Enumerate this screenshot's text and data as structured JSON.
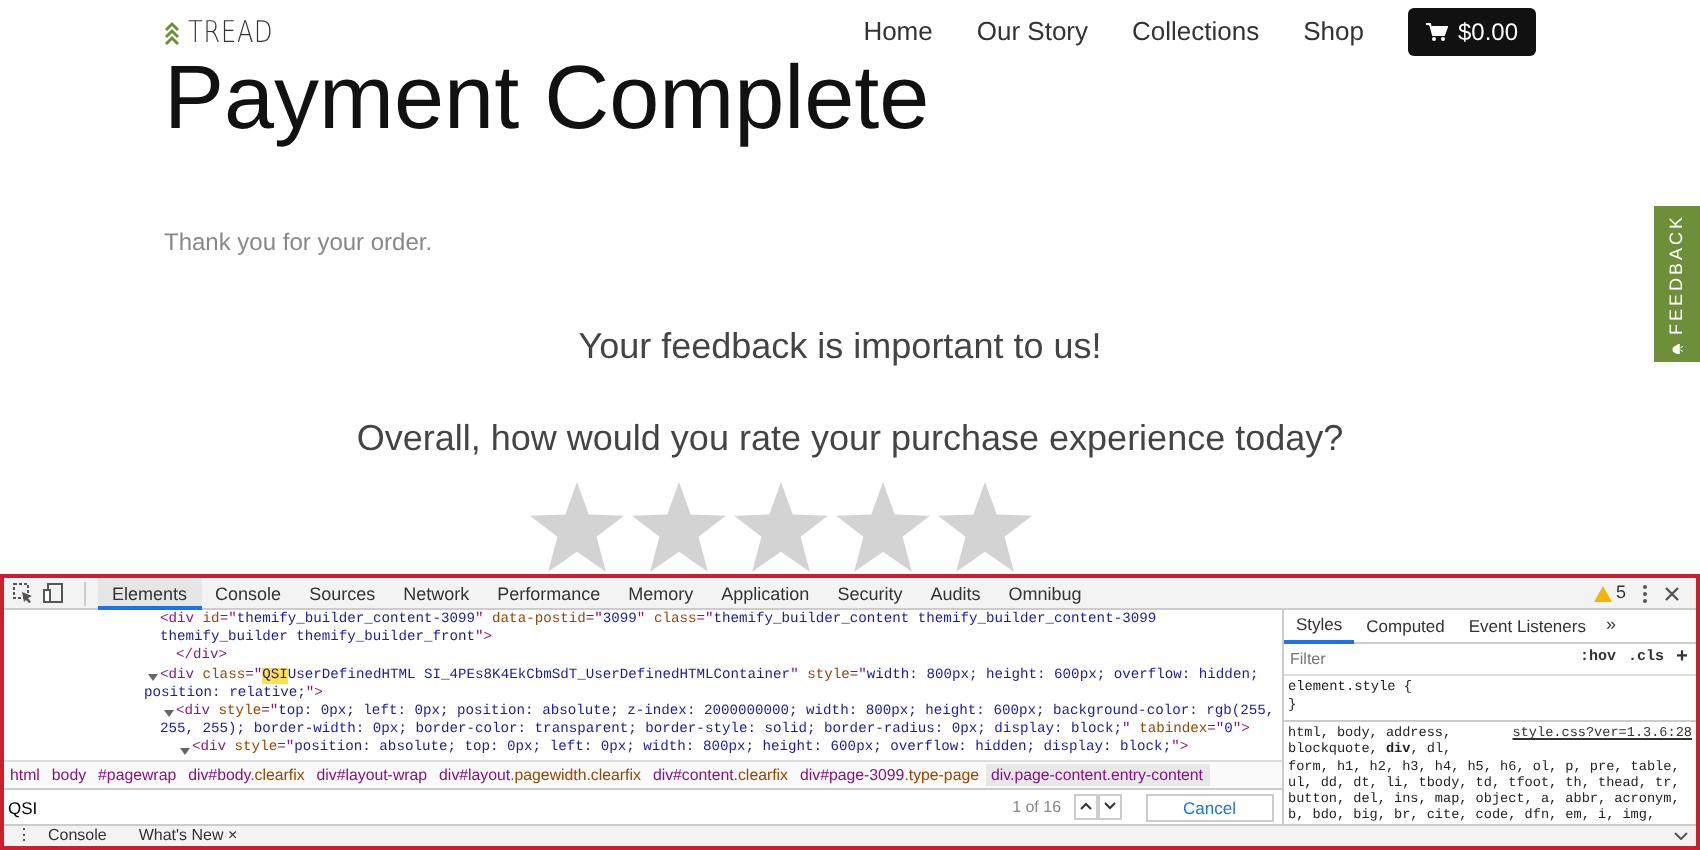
{
  "site": {
    "logo": "TREAD",
    "nav": [
      {
        "label": "Home"
      },
      {
        "label": "Our Story"
      },
      {
        "label": "Collections"
      },
      {
        "label": "Shop"
      }
    ],
    "cart": "$0.00",
    "title": "Payment Complete",
    "thanks": "Thank you for your order.",
    "feedback_heading": "Your feedback is important to us!",
    "question": "Overall, how would you rate your purchase experience today?",
    "stars": 0,
    "feedback_tab": "FEEDBACK"
  },
  "devtools": {
    "tabs": [
      {
        "label": "Elements",
        "selected": true
      },
      {
        "label": "Console",
        "selected": false
      },
      {
        "label": "Sources",
        "selected": false
      },
      {
        "label": "Network",
        "selected": false
      },
      {
        "label": "Performance",
        "selected": false
      },
      {
        "label": "Memory",
        "selected": false
      },
      {
        "label": "Application",
        "selected": false
      },
      {
        "label": "Security",
        "selected": false
      },
      {
        "label": "Audits",
        "selected": false
      },
      {
        "label": "Omnibug",
        "selected": false
      }
    ],
    "warnings": "5",
    "dom_tree": [
      {
        "lines": [
          [
            {
              "kind": "tag",
              "text": "<div "
            },
            {
              "kind": "attr",
              "text": "id"
            },
            {
              "kind": "tag",
              "text": "=\""
            },
            {
              "kind": "value",
              "text": "themify_builder_content-3099"
            },
            {
              "kind": "tag",
              "text": "\" "
            },
            {
              "kind": "attr",
              "text": "data-postid"
            },
            {
              "kind": "tag",
              "text": "=\""
            },
            {
              "kind": "value",
              "text": "3099"
            },
            {
              "kind": "tag",
              "text": "\" "
            },
            {
              "kind": "attr",
              "text": "class"
            },
            {
              "kind": "tag",
              "text": "=\""
            },
            {
              "kind": "value",
              "text": "themify_builder_content themify_builder_content-3099"
            }
          ],
          [
            {
              "kind": "value",
              "text": "themify_builder themify_builder_front"
            },
            {
              "kind": "tag",
              "text": "\">"
            }
          ]
        ],
        "children": [
          {
            "lines": [
              [
                {
                  "kind": "tag",
                  "text": "</div>"
                }
              ]
            ]
          }
        ]
      },
      {
        "expanded": true,
        "lines": [
          [
            {
              "kind": "tag",
              "text": "<div "
            },
            {
              "kind": "attr",
              "text": "class"
            },
            {
              "kind": "tag",
              "text": "=\""
            },
            {
              "kind": "match",
              "text": "QSI"
            },
            {
              "kind": "value",
              "text": "UserDefinedHTML SI_4PEs8K4EkCbmSdT_UserDefinedHTMLContainer"
            },
            {
              "kind": "tag",
              "text": "\" "
            },
            {
              "kind": "attr",
              "text": "style"
            },
            {
              "kind": "tag",
              "text": "=\""
            },
            {
              "kind": "value",
              "text": "width: 800px; height: 600px; overflow: hidden;"
            }
          ],
          [
            {
              "kind": "value",
              "text": "position: relative;"
            },
            {
              "kind": "tag",
              "text": "\">"
            }
          ]
        ],
        "children": [
          {
            "expanded": true,
            "lines": [
              [
                {
                  "kind": "tag",
                  "text": "<div "
                },
                {
                  "kind": "attr",
                  "text": "style"
                },
                {
                  "kind": "tag",
                  "text": "=\""
                },
                {
                  "kind": "value",
                  "text": "top: 0px; left: 0px; position: absolute; z-index: 2000000000; width: 800px; height: 600px; background-color: rgb(255,"
                }
              ],
              [
                {
                  "kind": "value",
                  "text": "255, 255); border-width: 0px; border-color: transparent; border-style: solid; border-radius: 0px; display: block;"
                },
                {
                  "kind": "tag",
                  "text": "\" "
                },
                {
                  "kind": "attr",
                  "text": "tabindex"
                },
                {
                  "kind": "tag",
                  "text": "=\""
                },
                {
                  "kind": "value",
                  "text": "0"
                },
                {
                  "kind": "tag",
                  "text": "\">"
                }
              ]
            ],
            "children": [
              {
                "expanded": true,
                "lines": [
                  [
                    {
                      "kind": "tag",
                      "text": "<div "
                    },
                    {
                      "kind": "attr",
                      "text": "style"
                    },
                    {
                      "kind": "tag",
                      "text": "=\""
                    },
                    {
                      "kind": "value",
                      "text": "position: absolute; top: 0px; left: 0px; width: 800px; height: 600px; overflow: hidden; display: block;"
                    },
                    {
                      "kind": "tag",
                      "text": "\">"
                    }
                  ]
                ]
              }
            ]
          }
        ]
      }
    ],
    "breadcrumbs": [
      {
        "tag": "html",
        "selected": false
      },
      {
        "tag": "body",
        "selected": false
      },
      {
        "tag": "#pagewrap",
        "selected": false
      },
      {
        "tag": "div#body",
        "rest": ".clearfix",
        "selected": false
      },
      {
        "tag": "div#layout-wrap",
        "selected": false
      },
      {
        "tag": "div#layout",
        "rest": ".pagewidth.clearfix",
        "selected": false
      },
      {
        "tag": "div#content",
        "rest": ".clearfix",
        "selected": false
      },
      {
        "tag": "div#page-3099",
        "rest": ".type-page",
        "selected": false
      },
      {
        "tag": "div.page-content.entry-content",
        "selected": true
      }
    ],
    "search": {
      "value": "QSI",
      "count": "1 of 16",
      "cancel": "Cancel"
    },
    "drawer": {
      "menu": "⋮",
      "tabs": [
        "Console",
        "What's New"
      ],
      "close": "×"
    },
    "side_tabs": [
      {
        "label": "Styles",
        "selected": true
      },
      {
        "label": "Computed",
        "selected": false
      },
      {
        "label": "Event Listeners",
        "selected": false
      }
    ],
    "more": "»",
    "filter": {
      "placeholder": "Filter",
      "hov": ":hov",
      "cls": ".cls",
      "add": "+"
    },
    "element_style": [
      "element.style {",
      "}"
    ],
    "rule": {
      "source": "style.css?ver=1.3.6:28",
      "lines": [
        "html, body, address,",
        "blockquote, **div**, dl,",
        "form, h1, h2, h3, h4, h5, h6, ol, p, pre, table,",
        "ul, dd, dt, li, tbody, td, tfoot, th, thead, tr,",
        "button, del, ins, map, object, a, abbr, acronym,",
        "b, bdo, big, br, cite, code, dfn, em, i, img,"
      ]
    }
  }
}
